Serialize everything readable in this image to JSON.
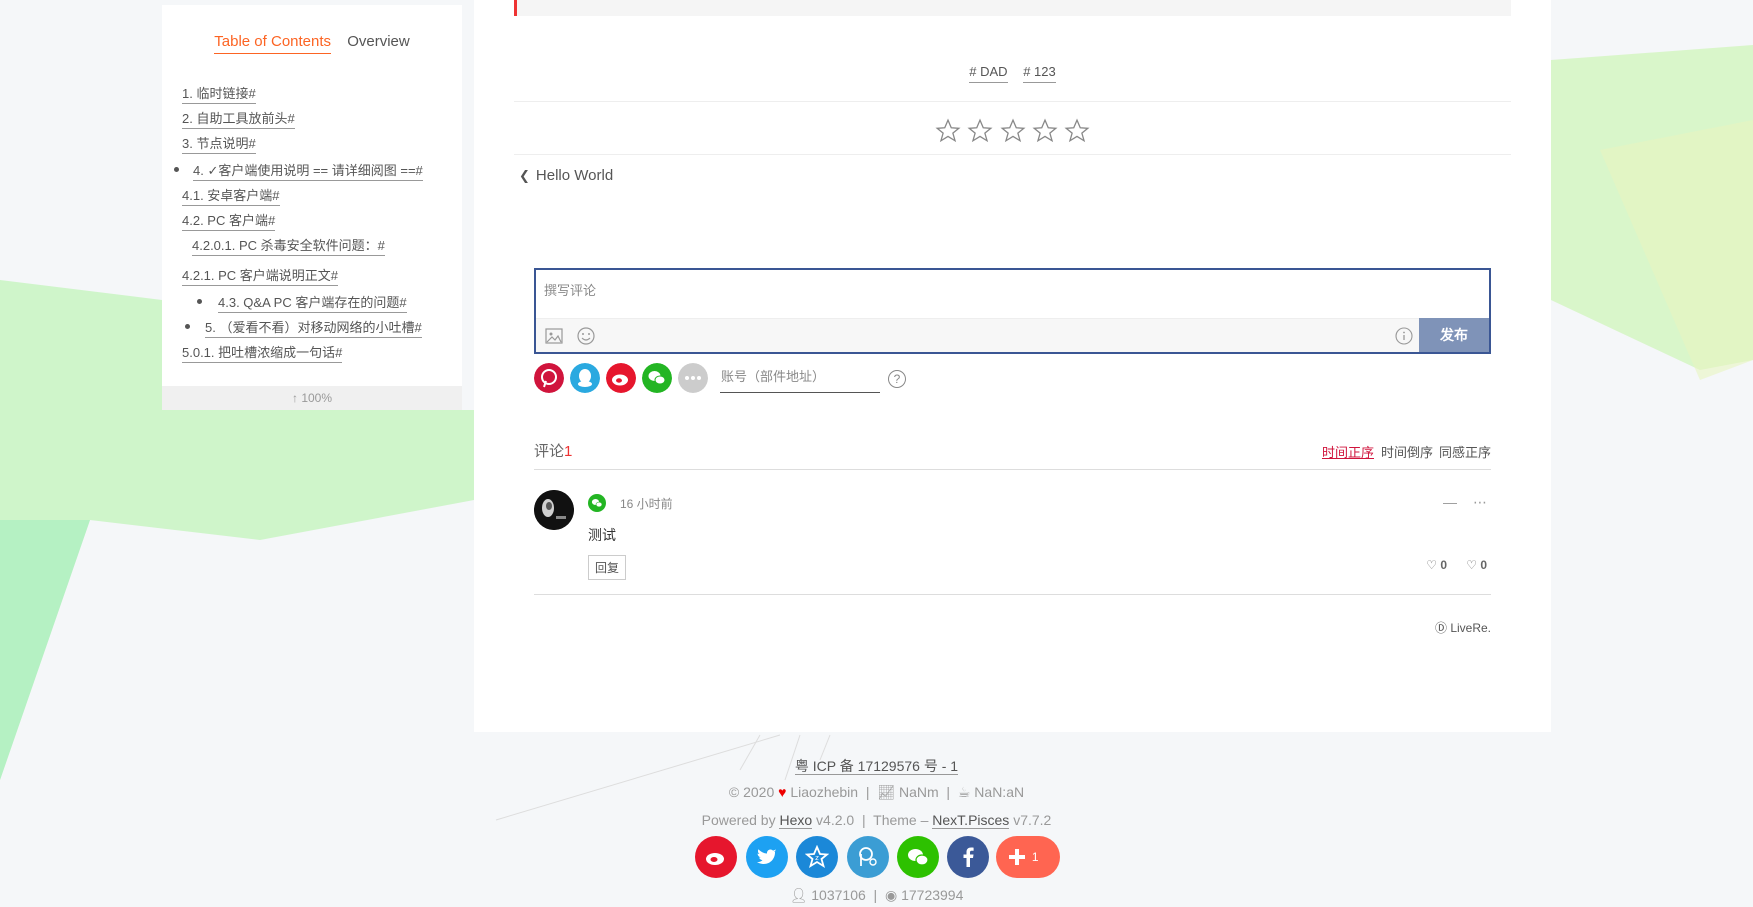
{
  "toc": {
    "tabs": [
      "Table of Contents",
      "Overview"
    ],
    "items": [
      "1. 临时链接#",
      "2. 自助工具放前头#",
      "3. 节点说明#",
      "4. ✓客户端使用说明 == 请详细阅图 ==#",
      "4.1. 安卓客户端#",
      "4.2. PC 客户端#",
      "4.2.0.1. PC 杀毒安全软件问题：#",
      "4.2.1. PC 客户端说明正文#",
      "4.3. Q&A PC 客户端存在的问题#",
      "5. （爱看不看）对移动网络的小吐槽#",
      "5.0.1. 把吐槽浓缩成一句话#"
    ],
    "progress": "100%"
  },
  "post": {
    "tags": [
      "# DAD",
      "# 123"
    ],
    "rating": {
      "max": 5,
      "value": 0
    },
    "prev_post": "Hello World"
  },
  "comment_box": {
    "placeholder": "撰写评论",
    "publish_label": "发布",
    "account_placeholder": "账号（部件地址）",
    "help_label": "?"
  },
  "comments": {
    "label": "评论",
    "count": "1",
    "sort_options": [
      "时间正序",
      "时间倒序",
      "同感正序"
    ],
    "items": [
      {
        "time": "16 小时前",
        "text": "测试",
        "reply_label": "回复",
        "likes": "0",
        "dislikes": "0"
      }
    ],
    "provider": "LiveRe."
  },
  "footer": {
    "icp": "粤 ICP 备 17129576 号 - 1",
    "copyright": "© 2020",
    "author": "Liaozhebin",
    "words": "NaNm",
    "time": "NaN:aN",
    "powered_by": "Powered by",
    "hexo": "Hexo",
    "hexo_version": "v4.2.0",
    "theme_label": "Theme –",
    "theme": "NexT.Pisces",
    "theme_version": "v7.7.2",
    "share_count": "1",
    "visitors": "1037106",
    "views": "17723994"
  },
  "colors": {
    "accent": "#fc6423",
    "publish": "#7f93b8",
    "comment_border": "#3a5694",
    "active_sort": "#d0143c"
  }
}
